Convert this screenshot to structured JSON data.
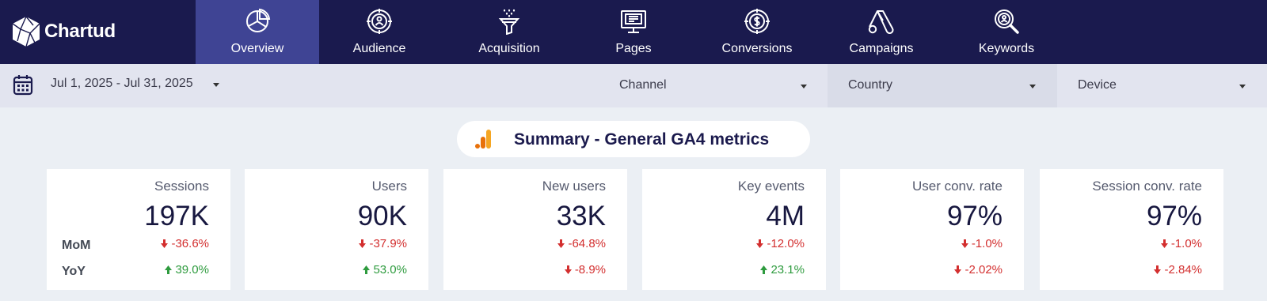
{
  "brand": {
    "name": "Chartud"
  },
  "nav": {
    "tabs": [
      {
        "label": "Overview",
        "icon": "pie-chart-icon",
        "active": true
      },
      {
        "label": "Audience",
        "icon": "audience-target-icon",
        "active": false
      },
      {
        "label": "Acquisition",
        "icon": "funnel-icon",
        "active": false
      },
      {
        "label": "Pages",
        "icon": "monitor-page-icon",
        "active": false
      },
      {
        "label": "Conversions",
        "icon": "dollar-target-icon",
        "active": false
      },
      {
        "label": "Campaigns",
        "icon": "google-ads-icon",
        "active": false
      },
      {
        "label": "Keywords",
        "icon": "magnifier-keyword-icon",
        "active": false
      }
    ]
  },
  "filters": {
    "date_range": "Jul 1, 2025 - Jul 31, 2025",
    "channel": "Channel",
    "country": "Country",
    "device": "Device"
  },
  "summary": {
    "title": "Summary - General GA4 metrics"
  },
  "row_labels": {
    "mom": "MoM",
    "yoy": "YoY"
  },
  "cards": [
    {
      "title": "Sessions",
      "value": "197K",
      "mom": "-36.6%",
      "mom_dir": "down",
      "yoy": "39.0%",
      "yoy_dir": "up"
    },
    {
      "title": "Users",
      "value": "90K",
      "mom": "-37.9%",
      "mom_dir": "down",
      "yoy": "53.0%",
      "yoy_dir": "up"
    },
    {
      "title": "New users",
      "value": "33K",
      "mom": "-64.8%",
      "mom_dir": "down",
      "yoy": "-8.9%",
      "yoy_dir": "down"
    },
    {
      "title": "Key events",
      "value": "4M",
      "mom": "-12.0%",
      "mom_dir": "down",
      "yoy": "23.1%",
      "yoy_dir": "up"
    },
    {
      "title": "User conv. rate",
      "value": "97%",
      "mom": "-1.0%",
      "mom_dir": "down",
      "yoy": "-2.02%",
      "yoy_dir": "down"
    },
    {
      "title": "Session conv. rate",
      "value": "97%",
      "mom": "-1.0%",
      "mom_dir": "down",
      "yoy": "-2.84%",
      "yoy_dir": "down"
    }
  ],
  "colors": {
    "nav_bg": "#1a1a4e",
    "nav_active": "#3f4494",
    "negative": "#d32f2f",
    "positive": "#2e9b3e",
    "accent_orange": "#f5a623"
  }
}
